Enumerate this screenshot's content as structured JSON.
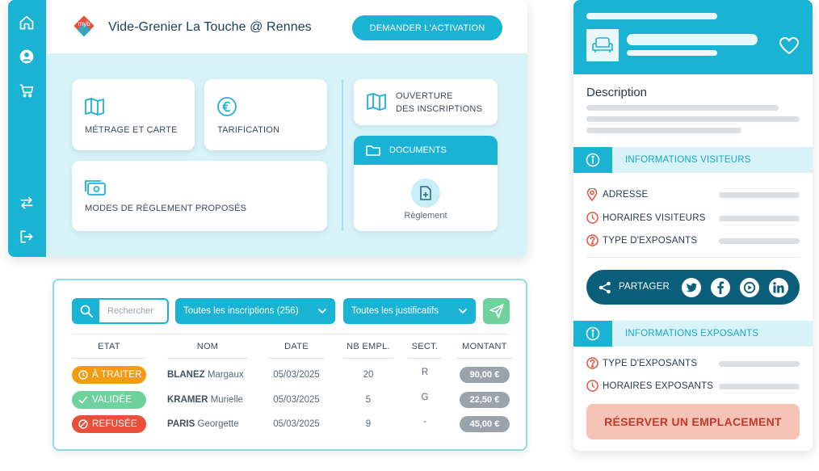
{
  "app": {
    "title": "Vide-Grenier La Touche @ Rennes",
    "logo_text": "myb",
    "activate_button": "DEMANDER L'ACTIVATION",
    "sidebar": [
      {
        "icon": "home-icon"
      },
      {
        "icon": "user-icon"
      },
      {
        "icon": "cart-icon"
      },
      {
        "icon": "switch-arrows-icon"
      },
      {
        "icon": "logout-icon"
      }
    ],
    "cards": {
      "metrage": "MÉTRAGE ET CARTE",
      "tarification": "TARIFICATION",
      "modes_reglement": "MODES DE RÈGLEMENT PROPOSÉS",
      "ouverture_line1": "OUVERTURE",
      "ouverture_line2": "DES INSCRIPTIONS",
      "documents": "DOCUMENTS",
      "reglement_doc": "Règlement"
    }
  },
  "table": {
    "search_placeholder": "Rechercher",
    "filter_inscriptions": "Toutes les inscriptions (256)",
    "filter_justificatifs": "Toutes les justificatifs",
    "columns": [
      "ETAT",
      "NOM",
      "DATE",
      "NB EMPL.",
      "SECT.",
      "MONTANT"
    ],
    "rows": [
      {
        "status": "À TRAITER",
        "status_color": "#f39c12",
        "status_icon": "clock-icon",
        "last": "BLANEZ",
        "first": "Margaux",
        "date": "05/03/2025",
        "nb": "20",
        "sect": "R",
        "amount": "90,00 €"
      },
      {
        "status": "VALIDÉE",
        "status_color": "#6fd19b",
        "status_icon": "check-icon",
        "last": "KRAMER",
        "first": "Murielle",
        "date": "05/03/2025",
        "nb": "5",
        "sect": "G",
        "amount": "22,50 €"
      },
      {
        "status": "REFUSÉE",
        "status_color": "#e8503a",
        "status_icon": "ban-icon",
        "last": "PARIS",
        "first": "Georgette",
        "date": "05/03/2025",
        "nb": "9",
        "sect": "-",
        "amount": "45,00 €"
      }
    ]
  },
  "detail": {
    "description_title": "Description",
    "visitors_section": "INFORMATIONS VISITEURS",
    "visitors_rows": [
      {
        "label": "ADRESSE",
        "icon": "pin-icon"
      },
      {
        "label": "HORAIRES VISITEURS",
        "icon": "clock-icon"
      },
      {
        "label": "TYPE D'EXPOSANTS",
        "icon": "question-icon"
      }
    ],
    "share_label": "PARTAGER",
    "social": [
      "twitter-icon",
      "facebook-icon",
      "youtube-icon",
      "linkedin-icon"
    ],
    "exhibitors_section": "INFORMATIONS EXPOSANTS",
    "exhibitors_rows": [
      {
        "label": "TYPE D'EXPOSANTS",
        "icon": "question-icon"
      },
      {
        "label": "HORAIRES EXPOSANTS",
        "icon": "clock-icon"
      }
    ],
    "reserve_button": "RÉSERVER UN EMPLACEMENT"
  },
  "colors": {
    "primary": "#1bb3d4",
    "light": "#d7f3f8",
    "dark": "#0b5e7a",
    "danger": "#e8503a",
    "reserve_bg": "#f8c3b7"
  }
}
